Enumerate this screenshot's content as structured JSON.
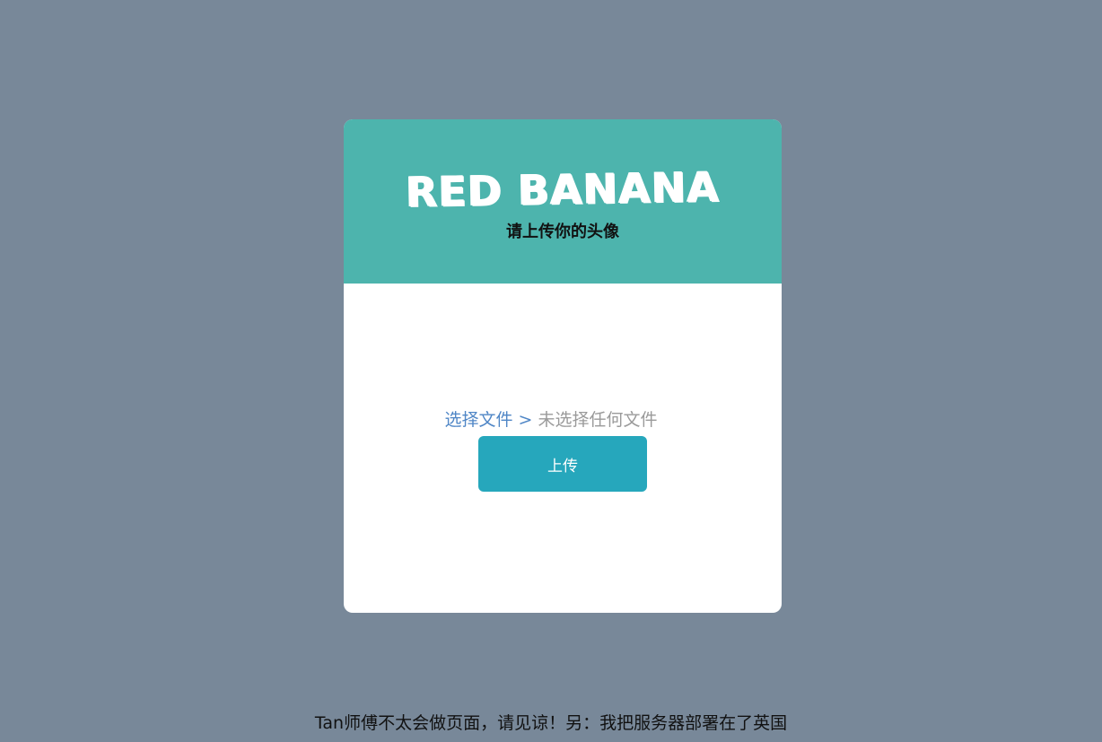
{
  "card": {
    "brand": "RED BANANA",
    "subtitle": "请上传你的头像",
    "file_pick_label": "选择文件 >",
    "file_status": "未选择任何文件",
    "upload_label": "上传"
  },
  "footer": {
    "note": "Tan师傅不太会做页面，请见谅！另：我把服务器部署在了英国"
  },
  "colors": {
    "background": "#788899",
    "header": "#4db4ad",
    "button": "#26a7bc",
    "link": "#4f86c6"
  }
}
